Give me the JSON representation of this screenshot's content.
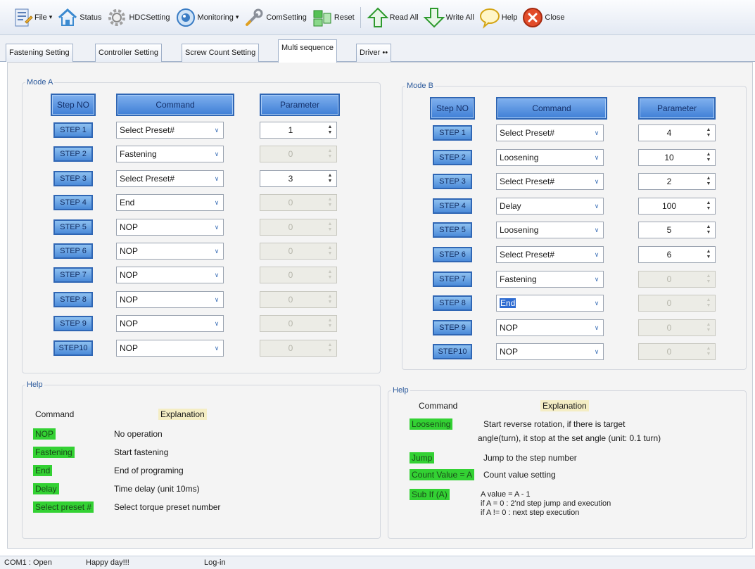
{
  "toolbar": {
    "file": "File",
    "status": "Status",
    "hdc": "HDCSetting",
    "monitoring": "Monitoring",
    "comsetting": "ComSetting",
    "reset": "Reset",
    "readall": "Read All",
    "writeall": "Write All",
    "help": "Help",
    "close": "Close"
  },
  "tabs": [
    "Fastening Setting",
    "Controller Setting",
    "Screw Count Setting",
    "Multi sequence",
    "Driver ••"
  ],
  "active_tab": "Multi sequence",
  "modeA": {
    "title": "Mode A",
    "hdr_step": "Step NO",
    "hdr_command": "Command",
    "hdr_param": "Parameter",
    "steps": [
      {
        "label": "STEP 1",
        "command": "Select Preset#",
        "param": "1",
        "enabled": true
      },
      {
        "label": "STEP 2",
        "command": "Fastening",
        "param": "0",
        "enabled": false
      },
      {
        "label": "STEP 3",
        "command": "Select Preset#",
        "param": "3",
        "enabled": true
      },
      {
        "label": "STEP 4",
        "command": "End",
        "param": "0",
        "enabled": false
      },
      {
        "label": "STEP 5",
        "command": "NOP",
        "param": "0",
        "enabled": false
      },
      {
        "label": "STEP 6",
        "command": "NOP",
        "param": "0",
        "enabled": false
      },
      {
        "label": "STEP 7",
        "command": "NOP",
        "param": "0",
        "enabled": false
      },
      {
        "label": "STEP 8",
        "command": "NOP",
        "param": "0",
        "enabled": false
      },
      {
        "label": "STEP 9",
        "command": "NOP",
        "param": "0",
        "enabled": false
      },
      {
        "label": "STEP10",
        "command": "NOP",
        "param": "0",
        "enabled": false
      }
    ]
  },
  "modeB": {
    "title": "Mode B",
    "hdr_step": "Step NO",
    "hdr_command": "Command",
    "hdr_param": "Parameter",
    "steps": [
      {
        "label": "STEP 1",
        "command": "Select Preset#",
        "param": "4",
        "enabled": true
      },
      {
        "label": "STEP 2",
        "command": "Loosening",
        "param": "10",
        "enabled": true
      },
      {
        "label": "STEP 3",
        "command": "Select Preset#",
        "param": "2",
        "enabled": true
      },
      {
        "label": "STEP 4",
        "command": "Delay",
        "param": "100",
        "enabled": true
      },
      {
        "label": "STEP 5",
        "command": "Loosening",
        "param": "5",
        "enabled": true
      },
      {
        "label": "STEP 6",
        "command": "Select Preset#",
        "param": "6",
        "enabled": true
      },
      {
        "label": "STEP 7",
        "command": "Fastening",
        "param": "0",
        "enabled": false
      },
      {
        "label": "STEP 8",
        "command": "End",
        "param": "0",
        "enabled": false,
        "highlighted": true
      },
      {
        "label": "STEP 9",
        "command": "NOP",
        "param": "0",
        "enabled": false
      },
      {
        "label": "STEP10",
        "command": "NOP",
        "param": "0",
        "enabled": false
      }
    ]
  },
  "helpA": {
    "title": "Help",
    "col_command": "Command",
    "col_explanation": "Explanation",
    "items": [
      {
        "cmd": "NOP",
        "text": "No operation"
      },
      {
        "cmd": "Fastening",
        "text": "Start fastening"
      },
      {
        "cmd": "End",
        "text": "End of programing"
      },
      {
        "cmd": "Delay",
        "text": "Time delay (unit 10ms)"
      },
      {
        "cmd": "Select preset #",
        "text": "Select torque preset number"
      }
    ]
  },
  "helpB": {
    "title": "Help",
    "col_command": "Command",
    "col_explanation": "Explanation",
    "items": [
      {
        "cmd": "Loosening",
        "lines": [
          "Start reverse rotation, if there is target",
          "angle(turn), it stop at the set angle (unit: 0.1 turn)"
        ]
      },
      {
        "cmd": "Jump",
        "lines": [
          "Jump to the step number"
        ]
      },
      {
        "cmd": "Count Value = A",
        "lines": [
          "Count value setting"
        ]
      },
      {
        "cmd": "Sub If (A)",
        "lines": [
          "A value = A - 1",
          "if A = 0 : 2'nd step jump and execution",
          "if A != 0 : next step execution"
        ]
      }
    ]
  },
  "statusbar": {
    "port": "COM1 : Open",
    "message": "Happy day!!!",
    "login": "Log-in"
  },
  "colors": {
    "step_button": "#4b8ad9",
    "header_button": "#3f7fd6",
    "help_chip_green": "#33d133",
    "help_chip_tan": "#f4edc4",
    "selection_highlight": "#2d6bd1"
  }
}
